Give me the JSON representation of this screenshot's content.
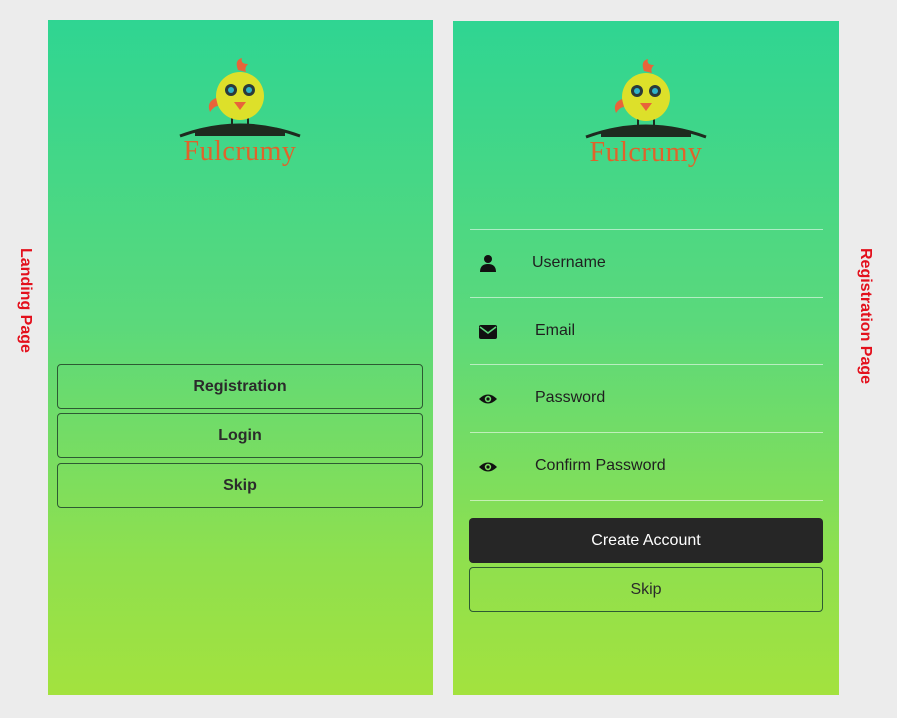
{
  "labels": {
    "landing": "Landing Page",
    "registration": "Registration Page"
  },
  "brand": {
    "name": "Fulcrumy"
  },
  "landing": {
    "buttons": [
      "Registration",
      "Login",
      "Skip"
    ]
  },
  "registration": {
    "fields": [
      {
        "placeholder": "Username",
        "icon": "person-icon"
      },
      {
        "placeholder": "Email",
        "icon": "envelope-icon"
      },
      {
        "placeholder": "Password",
        "icon": "eye-icon"
      },
      {
        "placeholder": "Confirm Password",
        "icon": "eye-icon"
      }
    ],
    "create_label": "Create Account",
    "skip_label": "Skip"
  },
  "colors": {
    "gradient_top": "#2fd592",
    "gradient_bottom": "#a3e23e",
    "brand": "#e0632b",
    "side_label": "#e3101c",
    "primary_button": "#262626"
  }
}
